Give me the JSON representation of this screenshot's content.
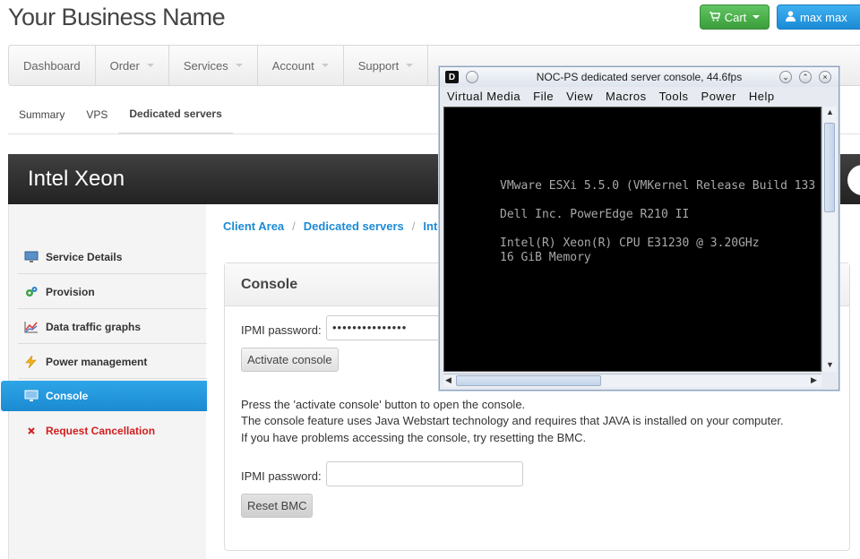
{
  "header": {
    "brand": "Your Business Name",
    "cart_label": "Cart",
    "user_label": "max max"
  },
  "mainnav": [
    "Dashboard",
    "Order",
    "Services",
    "Account",
    "Support"
  ],
  "subnav": [
    "Summary",
    "VPS",
    "Dedicated servers"
  ],
  "banner": {
    "title": "Intel Xeon"
  },
  "sidebar": {
    "items": [
      {
        "label": "Service Details",
        "icon": "monitor-icon"
      },
      {
        "label": "Provision",
        "icon": "gears-icon"
      },
      {
        "label": "Data traffic graphs",
        "icon": "chart-icon"
      },
      {
        "label": "Power management",
        "icon": "lightning-icon"
      },
      {
        "label": "Console",
        "icon": "monitor-icon"
      },
      {
        "label": "Request Cancellation",
        "icon": "cross-icon"
      }
    ]
  },
  "breadcrumb": {
    "items": [
      "Client Area",
      "Dedicated servers",
      "Inte"
    ]
  },
  "panel": {
    "title": "Console",
    "ipmi_label_1": "IPMI password:",
    "ipmi_value_1": "•••••••••••••••",
    "activate_button": "Activate console",
    "desc_1": "Press the 'activate console' button to open the console.",
    "desc_2": "The console feature uses Java Webstart technology and requires that JAVA is installed on your computer.",
    "desc_3": "If you have problems accessing the console, try resetting the BMC.",
    "ipmi_label_2": "IPMI password:",
    "ipmi_value_2": "",
    "reset_button": "Reset BMC"
  },
  "console_window": {
    "title": "NOC-PS dedicated server console, 44.6fps",
    "badge": "D",
    "menu": [
      "Virtual Media",
      "File",
      "View",
      "Macros",
      "Tools",
      "Power",
      "Help"
    ],
    "screen_lines": [
      "VMware ESXi 5.5.0 (VMKernel Release Build 133",
      "Dell Inc. PowerEdge R210 II",
      "Intel(R) Xeon(R) CPU E31230 @ 3.20GHz",
      "16 GiB Memory"
    ]
  }
}
